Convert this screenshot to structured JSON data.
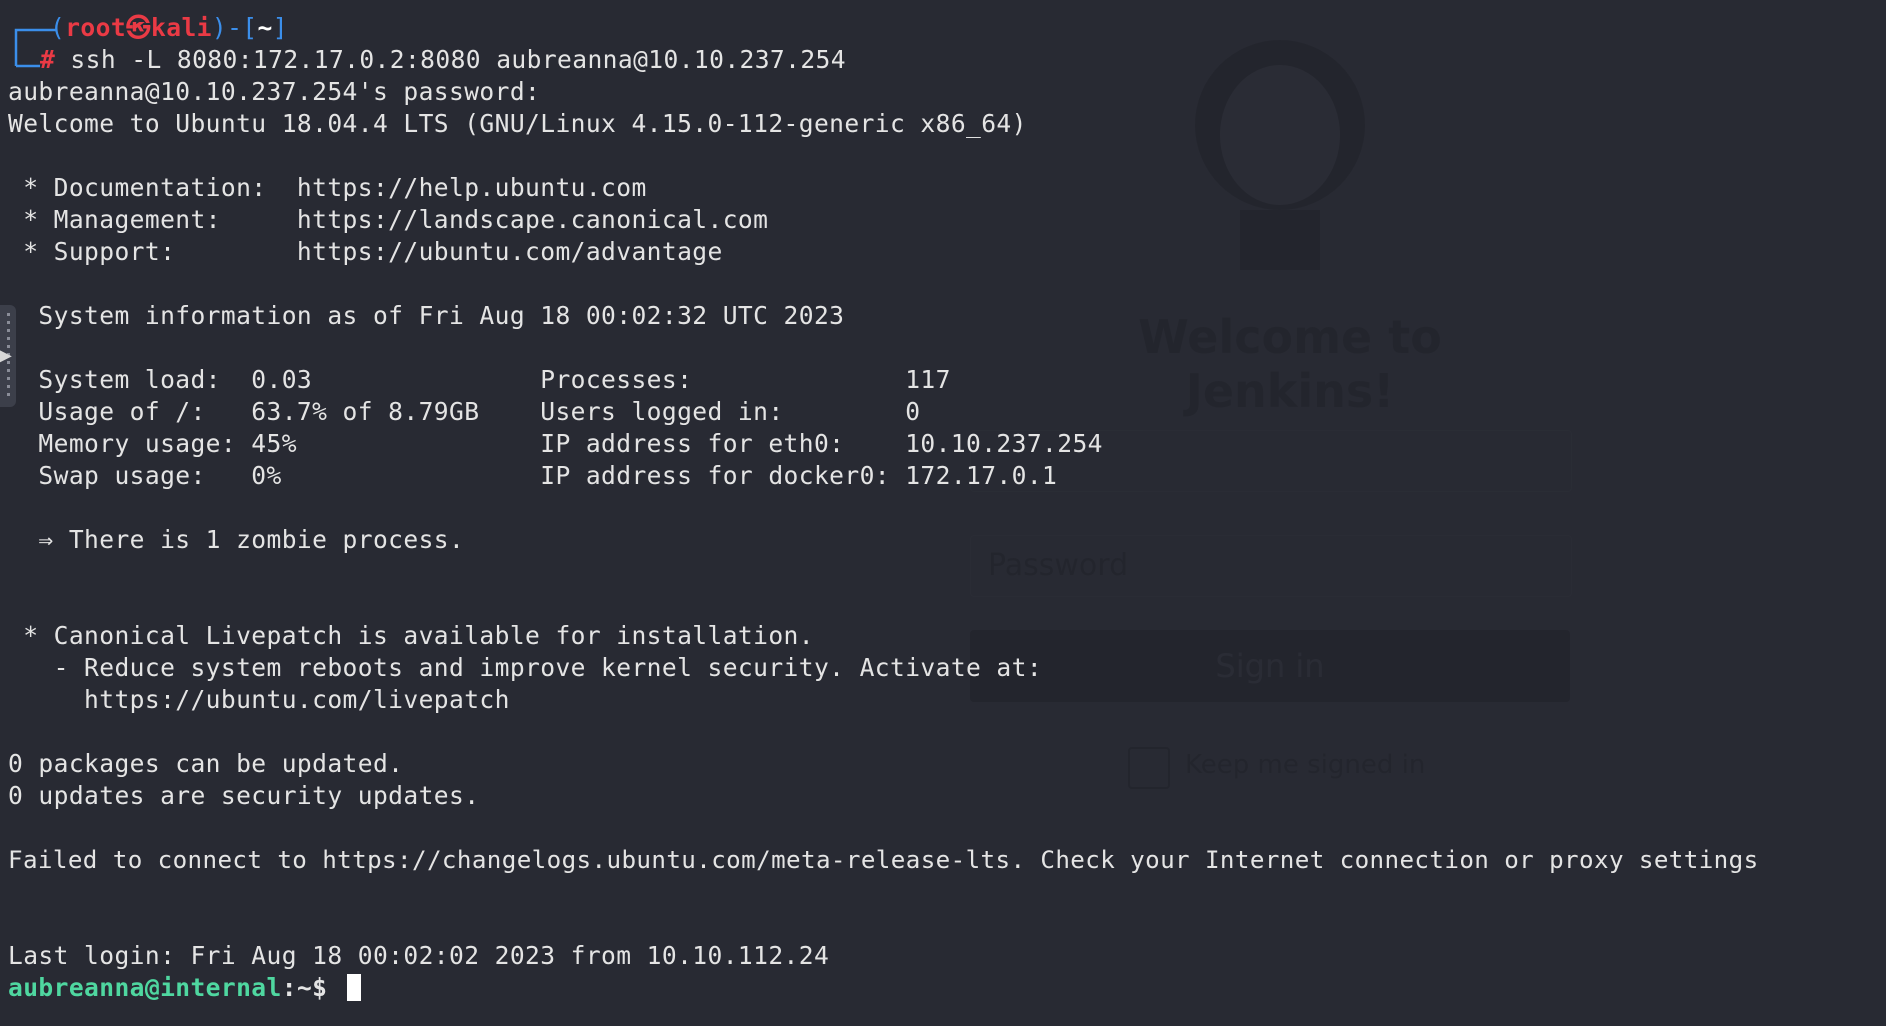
{
  "jenkins_overlay": {
    "title": "Welcome to Jenkins!",
    "password_placeholder": "Password",
    "sign_in_label": "Sign in",
    "keep_signed_in_label": "Keep me signed in"
  },
  "prompt1": {
    "open": "(",
    "user": "root",
    "at": "㉿",
    "host": "kali",
    "close": ")-[",
    "dir": "~",
    "end": "]",
    "hash": "#",
    "command": " ssh -L 8080:172.17.0.2:8080 aubreanna@10.10.237.254"
  },
  "output": {
    "password_prompt": "aubreanna@10.10.237.254's password:",
    "welcome": "Welcome to Ubuntu 18.04.4 LTS (GNU/Linux 4.15.0-112-generic x86_64)",
    "doc": " * Documentation:  https://help.ubuntu.com",
    "mgmt": " * Management:     https://landscape.canonical.com",
    "support": " * Support:        https://ubuntu.com/advantage",
    "sysinfo": "  System information as of Fri Aug 18 00:02:32 UTC 2023",
    "row1": "  System load:  0.03               Processes:              117",
    "row2": "  Usage of /:   63.7% of 8.79GB    Users logged in:        0",
    "row3": "  Memory usage: 45%                IP address for eth0:    10.10.237.254",
    "row4": "  Swap usage:   0%                 IP address for docker0: 172.17.0.1",
    "zombie": "  ⇒ There is 1 zombie process.",
    "livepatch1": " * Canonical Livepatch is available for installation.",
    "livepatch2": "   - Reduce system reboots and improve kernel security. Activate at:",
    "livepatch3": "     https://ubuntu.com/livepatch",
    "packages": "0 packages can be updated.",
    "security": "0 updates are security updates.",
    "failed": "Failed to connect to https://changelogs.ubuntu.com/meta-release-lts. Check your Internet connection or proxy settings",
    "last_login": "Last login: Fri Aug 18 00:02:02 2023 from 10.10.112.24"
  },
  "prompt2": {
    "userhost": "aubreanna@internal",
    "path": ":~$ "
  },
  "colors": {
    "background": "#282a33",
    "prompt_blue": "#3b8eea",
    "prompt_red": "#ea3a45",
    "prompt_green": "#4fd7a0",
    "text": "#e4e4e4"
  }
}
